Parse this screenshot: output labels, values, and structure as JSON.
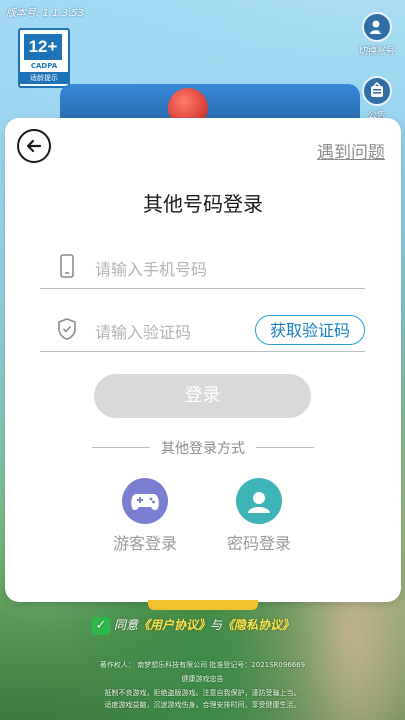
{
  "app": {
    "version": "版本号: 1.1.3.53"
  },
  "age_badge": {
    "rating": "12+",
    "org": "CADPA",
    "tip": "适龄提示"
  },
  "side_buttons": [
    {
      "label": "切换账号",
      "icon": "switch-account-icon"
    },
    {
      "label": "公告",
      "icon": "announcement-icon"
    }
  ],
  "login_card": {
    "help_link": "遇到问题",
    "title": "其他号码登录",
    "phone_placeholder": "请输入手机号码",
    "code_placeholder": "请输入验证码",
    "get_code_label": "获取验证码",
    "login_label": "登录",
    "other_methods_label": "其他登录方式",
    "methods": [
      {
        "label": "游客登录",
        "icon": "gamepad-icon",
        "color": "#7b7fd1"
      },
      {
        "label": "密码登录",
        "icon": "user-icon",
        "color": "#3fb4b8"
      }
    ]
  },
  "agreement": {
    "prefix": "同意",
    "user_agreement": "《用户协议》",
    "connector": "与",
    "privacy": "《隐私协议》"
  },
  "footer": {
    "line1": "著作权人：    南梦想乐科技有限公司    批准登记号：2021SR096669",
    "line2": "健康游戏忠告",
    "line3": "抵制不良游戏，拒绝盗版游戏。注意自我保护，谨防受骗上当。",
    "line4": "适度游戏益脑，沉迷游戏伤身。合理安排时间，享受健康生活。"
  },
  "colors": {
    "accent": "#2a9ee0",
    "login_disabled": "#d9d9d9",
    "badge": "#1e72b8"
  }
}
